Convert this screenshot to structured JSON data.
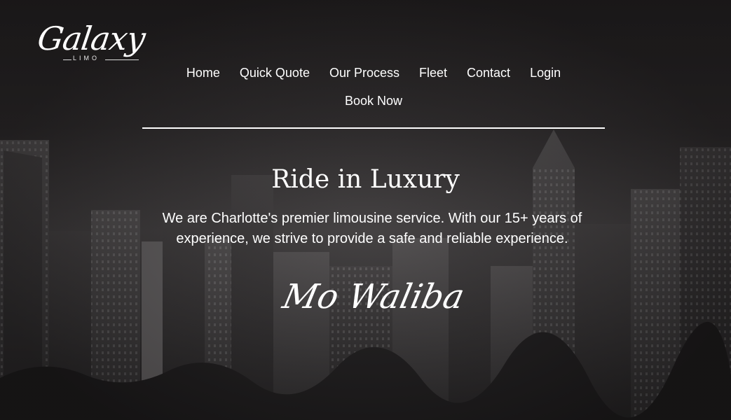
{
  "brand": {
    "name": "Galaxy",
    "subname": "LIMO"
  },
  "nav": {
    "items": [
      "Home",
      "Quick Quote",
      "Our Process",
      "Fleet",
      "Contact",
      "Login"
    ],
    "book_now": "Book Now"
  },
  "hero": {
    "title": "Ride in Luxury",
    "text": "We are Charlotte's premier limousine service. With our 15+ years of experience, we strive to provide a safe and reliable experience.",
    "signature": "Mo Waliba"
  },
  "colors": {
    "background": "#231f20",
    "text": "#ffffff"
  }
}
